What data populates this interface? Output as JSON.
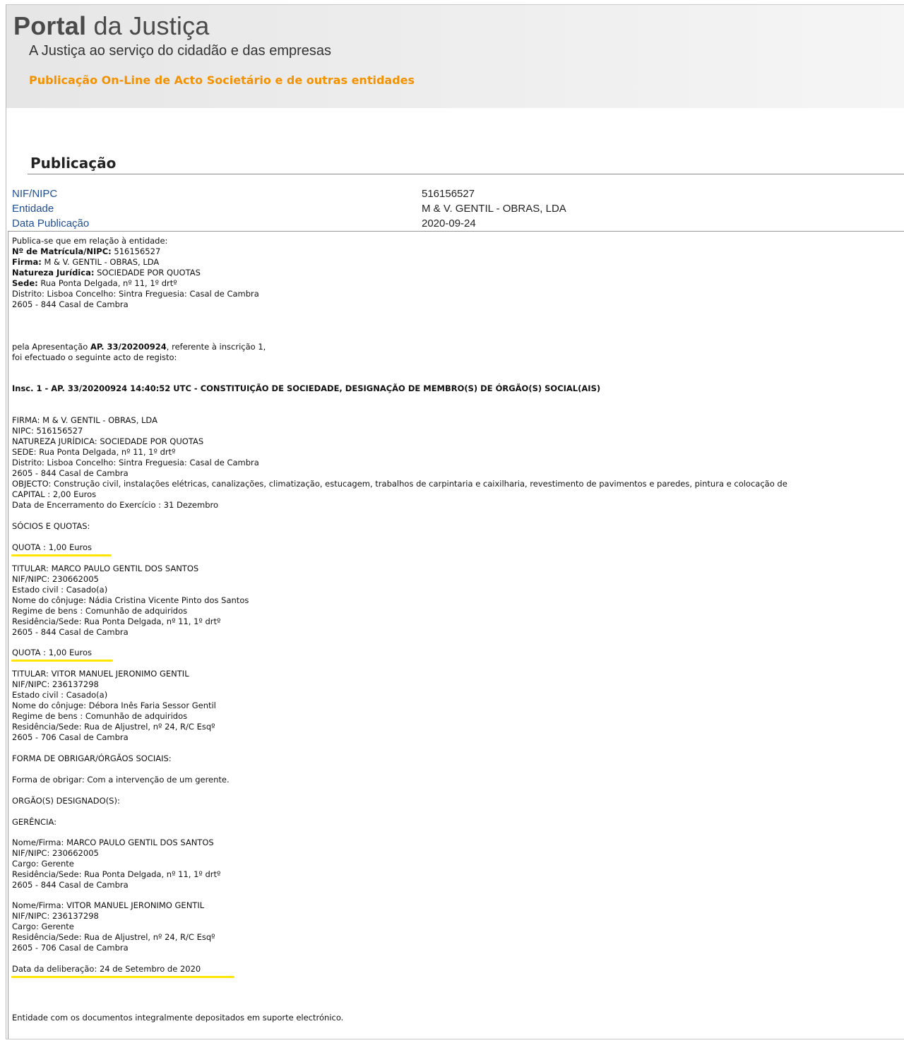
{
  "header": {
    "title_bold": "Portal",
    "title_rest": "da Justiça",
    "subtitle": "A Justiça ao serviço do cidadão e das empresas",
    "publication_type": "Publicação On-Line de Acto Societário e de outras entidades"
  },
  "section": {
    "title": "Publicação"
  },
  "meta": [
    {
      "label": "NIF/NIPC",
      "value": "516156527"
    },
    {
      "label": "Entidade",
      "value": "M & V. GENTIL - OBRAS, LDA"
    },
    {
      "label": "Data Publicação",
      "value": "2020-09-24"
    }
  ],
  "entity": {
    "intro": "Publica-se que em relação à entidade:",
    "matricula_label": "Nº de Matrícula/NIPC:",
    "matricula_value": " 516156527",
    "firma_label": "Firma:",
    "firma_value": " M & V. GENTIL - OBRAS, LDA",
    "natureza_label": "Natureza Jurídica:",
    "natureza_value": " SOCIEDADE POR QUOTAS",
    "sede_label": "Sede:",
    "sede_value": " Rua Ponta Delgada, nº 11, 1º drtº",
    "distrito": "Distrito: Lisboa Concelho: Sintra Freguesia: Casal de Cambra",
    "postal": "2605 - 844 Casal de Cambra"
  },
  "presentation": {
    "prefix": "pela Apresentação ",
    "ap": "AP. 33/20200924",
    "suffix": ", referente à inscrição 1,",
    "line2": "foi efectuado o seguinte acto de registo:"
  },
  "inscription_title": "Insc. 1 - AP. 33/20200924 14:40:52 UTC - CONSTITUIÇÃO DE SOCIEDADE, DESIGNAÇÃO DE MEMBRO(S) DE ÓRGÃO(S) SOCIAL(AIS)",
  "details": [
    "FIRMA: M & V. GENTIL - OBRAS, LDA",
    "NIPC: 516156527",
    "NATUREZA JURÍDICA: SOCIEDADE POR QUOTAS",
    "SEDE: Rua Ponta Delgada, nº 11, 1º drtº",
    "Distrito: Lisboa Concelho: Sintra Freguesia: Casal de Cambra",
    "2605 - 844 Casal de Cambra",
    "OBJECTO: Construção civil, instalações elétricas, canalizações, climatização, estucagem, trabalhos de carpintaria e caixilharia, revestimento de pavimentos e paredes, pintura e colocação de",
    "CAPITAL : 2,00 Euros",
    "Data de Encerramento do Exercício : 31 Dezembro"
  ],
  "socios_title": "SÓCIOS E QUOTAS:",
  "quota1": "QUOTA : 1,00 Euros",
  "titular1": [
    "TITULAR: MARCO PAULO GENTIL DOS SANTOS",
    "NIF/NIPC: 230662005",
    "Estado civil : Casado(a)",
    "Nome do cônjuge: Nádia Cristina Vicente Pinto dos Santos",
    "Regime de bens : Comunhão de adquiridos",
    "Residência/Sede: Rua Ponta Delgada, nº 11, 1º drtº",
    "2605 - 844 Casal de Cambra"
  ],
  "quota2": "QUOTA : 1,00 Euros",
  "titular2": [
    "TITULAR: VITOR MANUEL JERONIMO GENTIL",
    "NIF/NIPC: 236137298",
    "Estado civil : Casado(a)",
    "Nome do cônjuge: Débora Inês Faria Sessor Gentil",
    "Regime de bens : Comunhão de adquiridos",
    "Residência/Sede: Rua de Aljustrel, nº 24, R/C Esqº",
    "2605 - 706 Casal de Cambra"
  ],
  "forma_title": "FORMA DE OBRIGAR/ÓRGÃOS SOCIAIS:",
  "forma_value": "Forma de obrigar: Com a intervenção de um gerente.",
  "orgaos_title": "ORGÃO(S) DESIGNADO(S):",
  "gerencia_title": "GERÊNCIA:",
  "gerente1": [
    "Nome/Firma: MARCO PAULO GENTIL DOS SANTOS",
    "NIF/NIPC: 230662005",
    "Cargo: Gerente",
    "Residência/Sede: Rua Ponta Delgada, nº 11, 1º drtº",
    "2605 - 844 Casal de Cambra"
  ],
  "gerente2": [
    "Nome/Firma: VITOR MANUEL JERONIMO GENTIL",
    "NIF/NIPC: 236137298",
    "Cargo: Gerente",
    "Residência/Sede: Rua de Aljustrel, nº 24, R/C Esqº",
    "2605 - 706 Casal de Cambra"
  ],
  "deliberation": "Data da deliberação: 24 de Setembro de 2020",
  "footer": "Entidade com os documentos integralmente depositados em suporte electrónico.",
  "colors": {
    "orange": "#f39200",
    "label_blue": "#1f4e96",
    "highlight_yellow": "#ffe600"
  }
}
